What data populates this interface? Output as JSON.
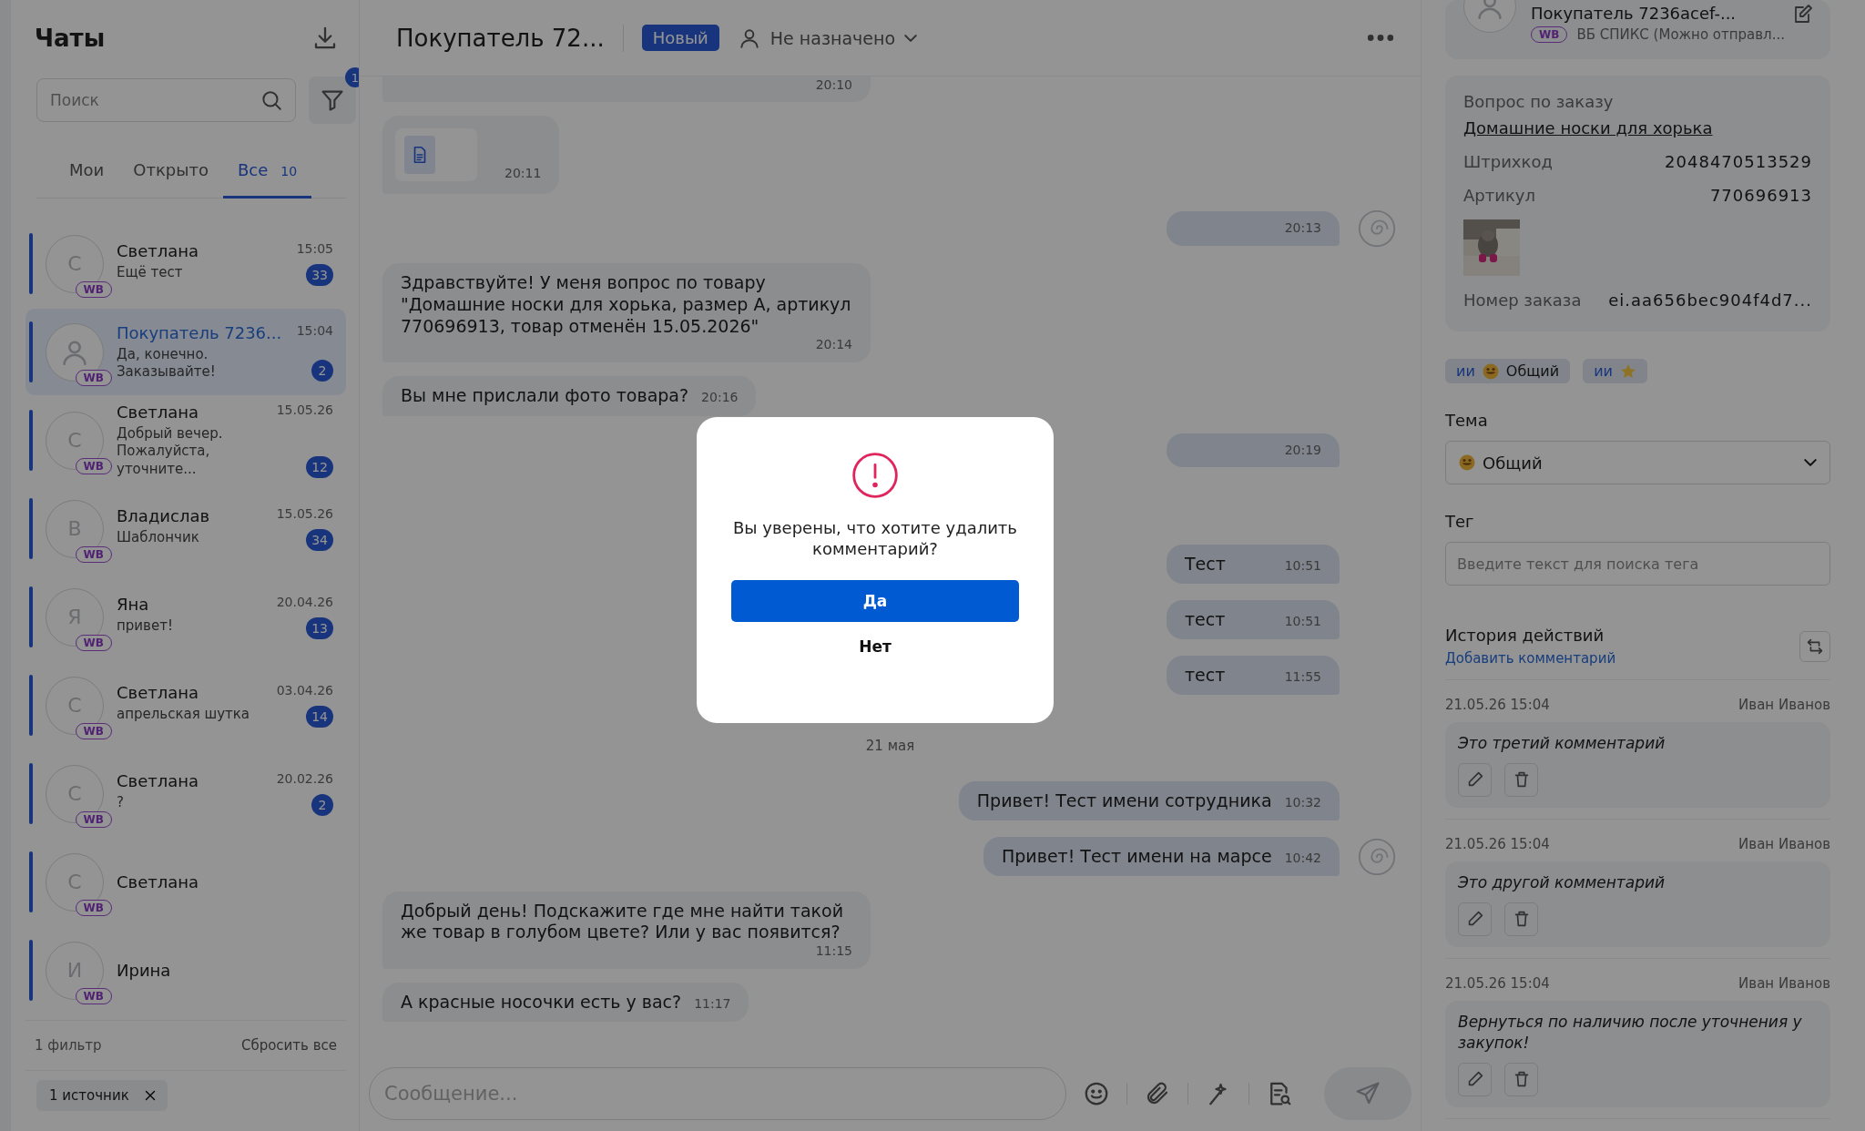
{
  "sidebar": {
    "title": "Чаты",
    "search": {
      "placeholder": "Поиск"
    },
    "filter_count": "1",
    "tabs": [
      {
        "label": "Мои",
        "selected": false
      },
      {
        "label": "Открыто",
        "selected": false
      },
      {
        "label": "Все",
        "count": "10",
        "selected": true
      }
    ],
    "chats": [
      {
        "avatar": "С",
        "name": "Светлана",
        "time": "15:05",
        "preview": "Ещё тест",
        "unread": "33",
        "source": "WB",
        "selected": false
      },
      {
        "name": "Покупатель 7236...",
        "time": "15:04",
        "preview": "Да, конечно. Заказывайте!",
        "unread": "2",
        "source": "WB",
        "selected": true
      },
      {
        "avatar": "С",
        "name": "Светлана",
        "time": "15.05.26",
        "preview": "Добрый вечер. Пожалуйста, уточните...",
        "unread": "12",
        "source": "WB",
        "selected": false
      },
      {
        "avatar": "В",
        "name": "Владислав",
        "time": "15.05.26",
        "preview": "Шаблончик",
        "unread": "34",
        "source": "WB",
        "selected": false
      },
      {
        "avatar": "Я",
        "name": "Яна",
        "time": "20.04.26",
        "preview": "привет!",
        "unread": "13",
        "source": "WB",
        "selected": false
      },
      {
        "avatar": "С",
        "name": "Светлана",
        "time": "03.04.26",
        "preview": "апрельская шутка",
        "unread": "14",
        "source": "WB",
        "selected": false
      },
      {
        "avatar": "С",
        "name": "Светлана",
        "time": "20.02.26",
        "preview": "?",
        "unread": "2",
        "source": "WB",
        "selected": false
      },
      {
        "avatar": "С",
        "name": "Светлана",
        "source": "WB",
        "selected": false
      },
      {
        "avatar": "И",
        "name": "Ирина",
        "source": "WB",
        "selected": false
      }
    ],
    "footer": {
      "filters": "1 фильтр",
      "reset": "Сбросить все",
      "chips": [
        {
          "label": "1 источник"
        }
      ]
    }
  },
  "chat": {
    "title": "Покупатель 72...",
    "status": "Новый",
    "assignee": "Не назначено",
    "messages": [
      {
        "kind": "incoming",
        "time": "20:10"
      },
      {
        "kind": "file",
        "time": "20:11"
      },
      {
        "kind": "outgoing",
        "time": "20:13",
        "bot": true
      },
      {
        "kind": "incoming",
        "text": "Здравствуйте! У меня вопрос по товару \"Домашние носки для хорька, размер А, артикул 770696913, товар отменён 15.05.2026\"",
        "time": "20:14"
      },
      {
        "kind": "incoming",
        "text": "Вы мне прислали фото товара?",
        "time": "20:16"
      },
      {
        "kind": "outgoing",
        "time": "20:19",
        "bot": false
      },
      {
        "kind": "outgoing",
        "text": "Тест",
        "time": "10:51",
        "bot": false,
        "gap": true
      },
      {
        "kind": "outgoing",
        "text": "тест",
        "time": "10:51",
        "bot": false
      },
      {
        "kind": "outgoing",
        "text": "тест",
        "time": "11:55",
        "bot": false
      },
      {
        "kind": "date",
        "text": "21 мая"
      },
      {
        "kind": "outgoing",
        "text": "Привет! Тест имени сотрудника",
        "time": "10:32",
        "bot": false
      },
      {
        "kind": "outgoing",
        "text": "Привет! Тест имени на марсе",
        "time": "10:42",
        "bot": true
      },
      {
        "kind": "incoming",
        "text": "Добрый день! Подскажите где мне найти такой же товар в голубом цвете? Или у вас появится?",
        "time": "11:15"
      },
      {
        "kind": "incoming",
        "text": "А красные носочки есть у вас?",
        "time": "11:17"
      }
    ],
    "composer": {
      "placeholder": "Сообщение..."
    }
  },
  "modal": {
    "message": "Вы уверены, что хотите удалить комментарий?",
    "confirm": "Да",
    "cancel": "Нет"
  },
  "details": {
    "customer": {
      "name": "Покупатель 7236acef-...",
      "source": "WB",
      "channel": "ВБ СПИКС (Можно отправл..."
    },
    "order": {
      "heading": "Вопрос по заказу",
      "product": "Домашние носки для хорька",
      "fields": [
        {
          "label": "Штрихкод",
          "value": "2048470513529"
        },
        {
          "label": "Артикул",
          "value": "770696913"
        }
      ],
      "order_number": {
        "label": "Номер заказа",
        "value": "ei.aa656bec904f4d7..."
      }
    },
    "tags": [
      {
        "kind": "topic",
        "prefix": "ии",
        "label": "Общий"
      },
      {
        "kind": "favorite",
        "prefix": "ии"
      }
    ],
    "topic": {
      "label": "Тема",
      "value": "Общий"
    },
    "tag_field": {
      "label": "Тег",
      "placeholder": "Введите текст для поиска тега"
    },
    "history": {
      "title": "История действий",
      "add_link": "Добавить комментарий",
      "comments": [
        {
          "date": "21.05.26 15:04",
          "author": "Иван Иванов",
          "text": "Это третий комментарий"
        },
        {
          "date": "21.05.26 15:04",
          "author": "Иван Иванов",
          "text": "Это другой комментарий"
        },
        {
          "date": "21.05.26 15:04",
          "author": "Иван Иванов",
          "text": "Вернуться по наличию после уточнения у закупок!"
        }
      ]
    }
  }
}
